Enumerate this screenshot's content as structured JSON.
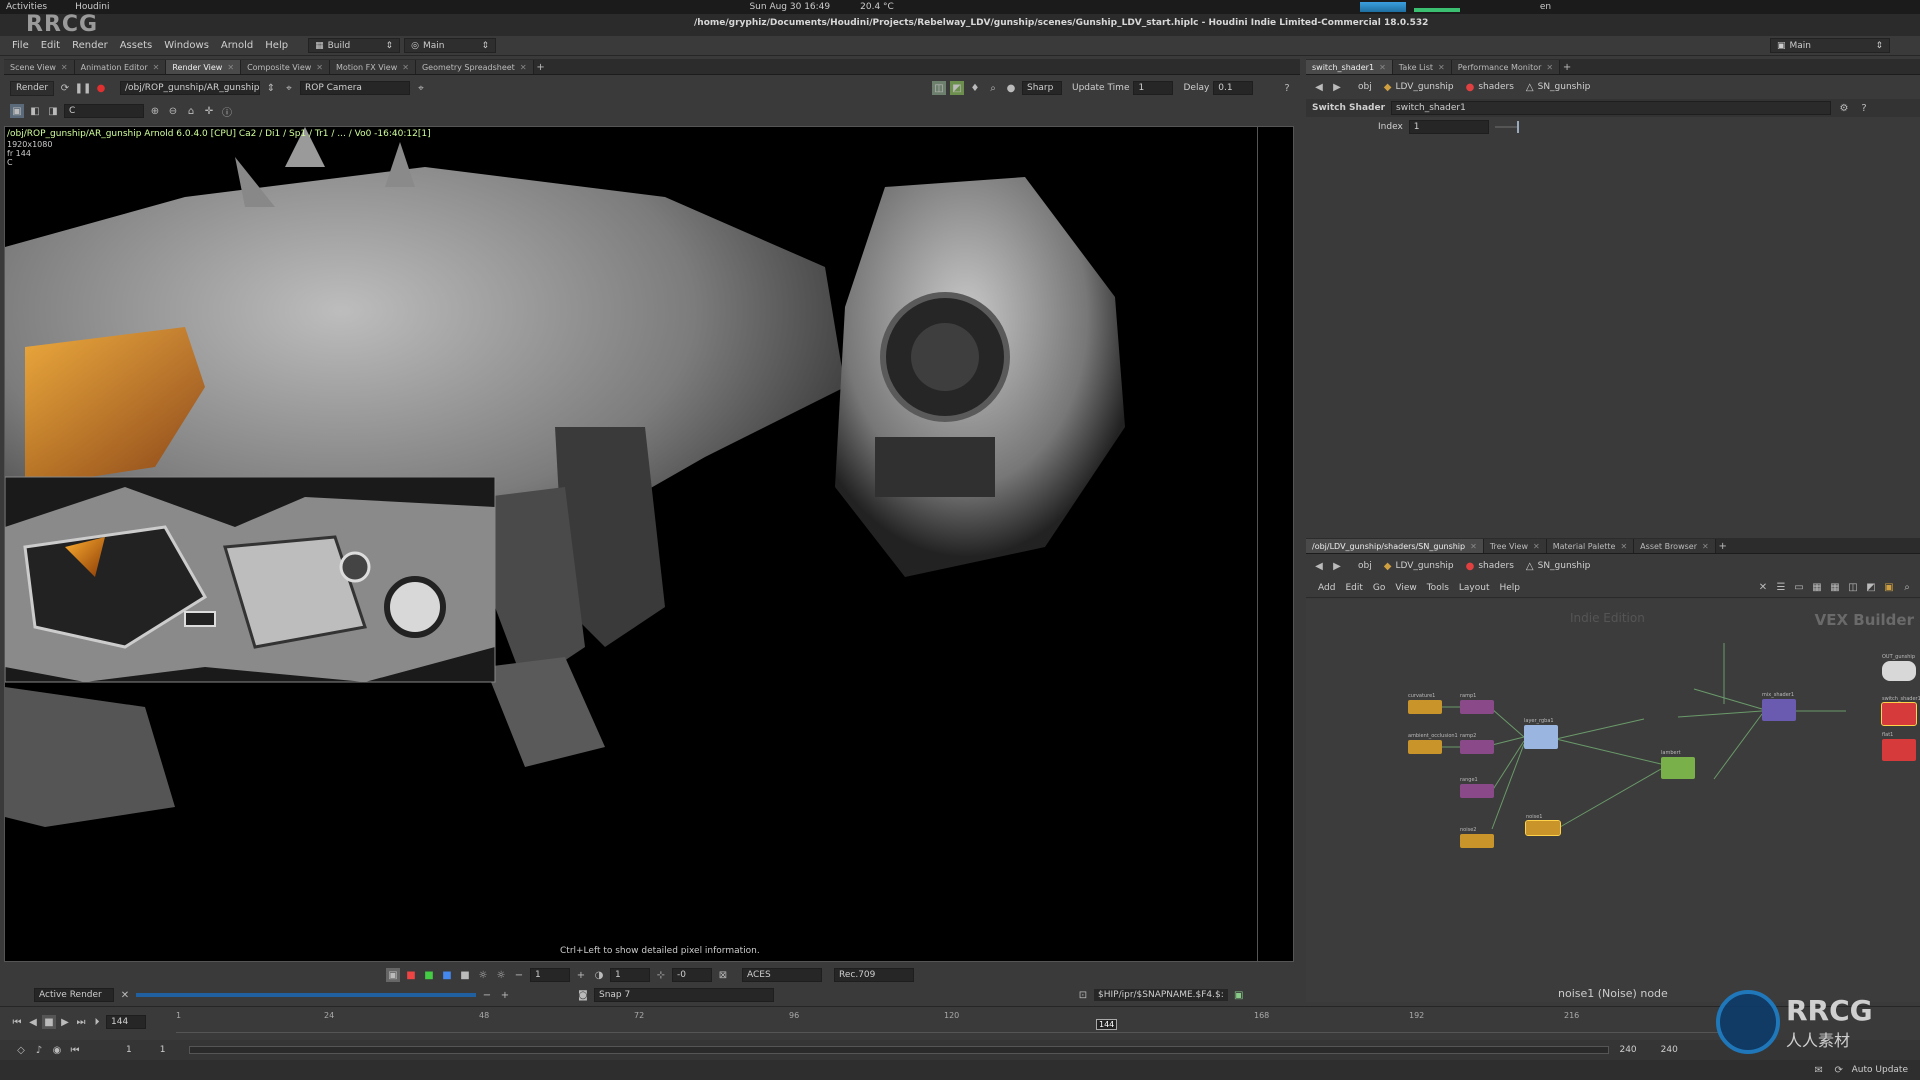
{
  "sysbar": {
    "activities": "Activities",
    "app": "Houdini",
    "clock": "Sun Aug 30  16:49",
    "temp": "20.4 °C",
    "lang": "en"
  },
  "window": {
    "logo": "RRCG",
    "path": "/home/gryphiz/Documents/Houdini/Projects/Rebelway_LDV/gunship/scenes/Gunship_LDV_start.hiplc - Houdini Indie Limited-Commercial 18.0.532"
  },
  "menu": [
    "File",
    "Edit",
    "Render",
    "Assets",
    "Windows",
    "Arnold",
    "Help"
  ],
  "shelf": {
    "build": "Build",
    "main": "Main",
    "desk": "Main"
  },
  "left_tabs": [
    "Scene View",
    "Animation Editor",
    "Render View",
    "Composite View",
    "Motion FX View",
    "Geometry Spreadsheet"
  ],
  "active_left_tab": 2,
  "render_toolbar": {
    "render": "Render",
    "rop_path": "/obj/ROP_gunship/AR_gunship",
    "camera": "ROP Camera",
    "sharp": "Sharp",
    "update_label": "Update Time",
    "update_value": "1",
    "delay_label": "Delay",
    "delay_value": "0.1",
    "channel": "C"
  },
  "viewport": {
    "info_line": "/obj/ROP_gunship/AR_gunship  Arnold 6.0.4.0 [CPU] Ca2 / Di1 / Sp1 / Tr1 / ... / Vo0 -16:40:12[1]",
    "resolution": "1920x1080",
    "frame": "fr 144",
    "channel": "C",
    "hint": "Ctrl+Left to show detailed pixel information."
  },
  "view_bottom": {
    "val1": "1",
    "val2": "1",
    "val3": "-0",
    "colorspace": "ACES",
    "display": "Rec.709",
    "active_render": "Active Render",
    "snap": "Snap 7",
    "snap_path": "$HIP/ipr/$SNAPNAME.$F4.$:"
  },
  "right_top_tabs": [
    "switch_shader1",
    "Take List",
    "Performance Monitor"
  ],
  "path_bar": {
    "obj": "obj",
    "ldv": "LDV_gunship",
    "shaders": "shaders",
    "sn": "SN_gunship"
  },
  "params": {
    "type": "Switch Shader",
    "name": "switch_shader1",
    "index_label": "Index",
    "index_value": "1"
  },
  "right_bottom_tabs": [
    "/obj/LDV_gunship/shaders/SN_gunship",
    "Tree View",
    "Material Palette",
    "Asset Browser"
  ],
  "net_menu": [
    "Add",
    "Edit",
    "Go",
    "View",
    "Tools",
    "Layout",
    "Help"
  ],
  "network": {
    "indie": "Indie Edition",
    "builder": "VEX Builder",
    "selected": "noise1 (Noise) node"
  },
  "nodes": [
    {
      "label": "curvature1",
      "color": "#c9952a"
    },
    {
      "label": "ramp1",
      "color": "#8a4a8a"
    },
    {
      "label": "ambient_occlusion1",
      "color": "#c9952a"
    },
    {
      "label": "ramp2",
      "color": "#8a4a8a"
    },
    {
      "label": "range1",
      "color": "#8a4a8a"
    },
    {
      "label": "layer_rgba1",
      "color": "#9ab6e0"
    },
    {
      "label": "mix_shader1",
      "color": "#6a5ab0"
    },
    {
      "label": "lambert",
      "color": "#7ab04a"
    },
    {
      "label": "noise1",
      "color": "#c9952a"
    },
    {
      "label": "noise2",
      "color": "#c9952a"
    },
    {
      "label": "OUT_gunship",
      "color": "#d8d8d8"
    },
    {
      "label": "switch_shader1",
      "color": "#d63a3a"
    },
    {
      "label": "flat1",
      "color": "#d63a3a"
    }
  ],
  "timeline": {
    "frame": "144",
    "ticks": [
      "1",
      "24",
      "48",
      "72",
      "96",
      "120",
      "144",
      "168",
      "192",
      "216"
    ],
    "start": "1",
    "start2": "1",
    "end": "240",
    "end2": "240",
    "auto_update": "Auto Update"
  },
  "watermark": "RRCG",
  "watermark_cn": "人人素材"
}
